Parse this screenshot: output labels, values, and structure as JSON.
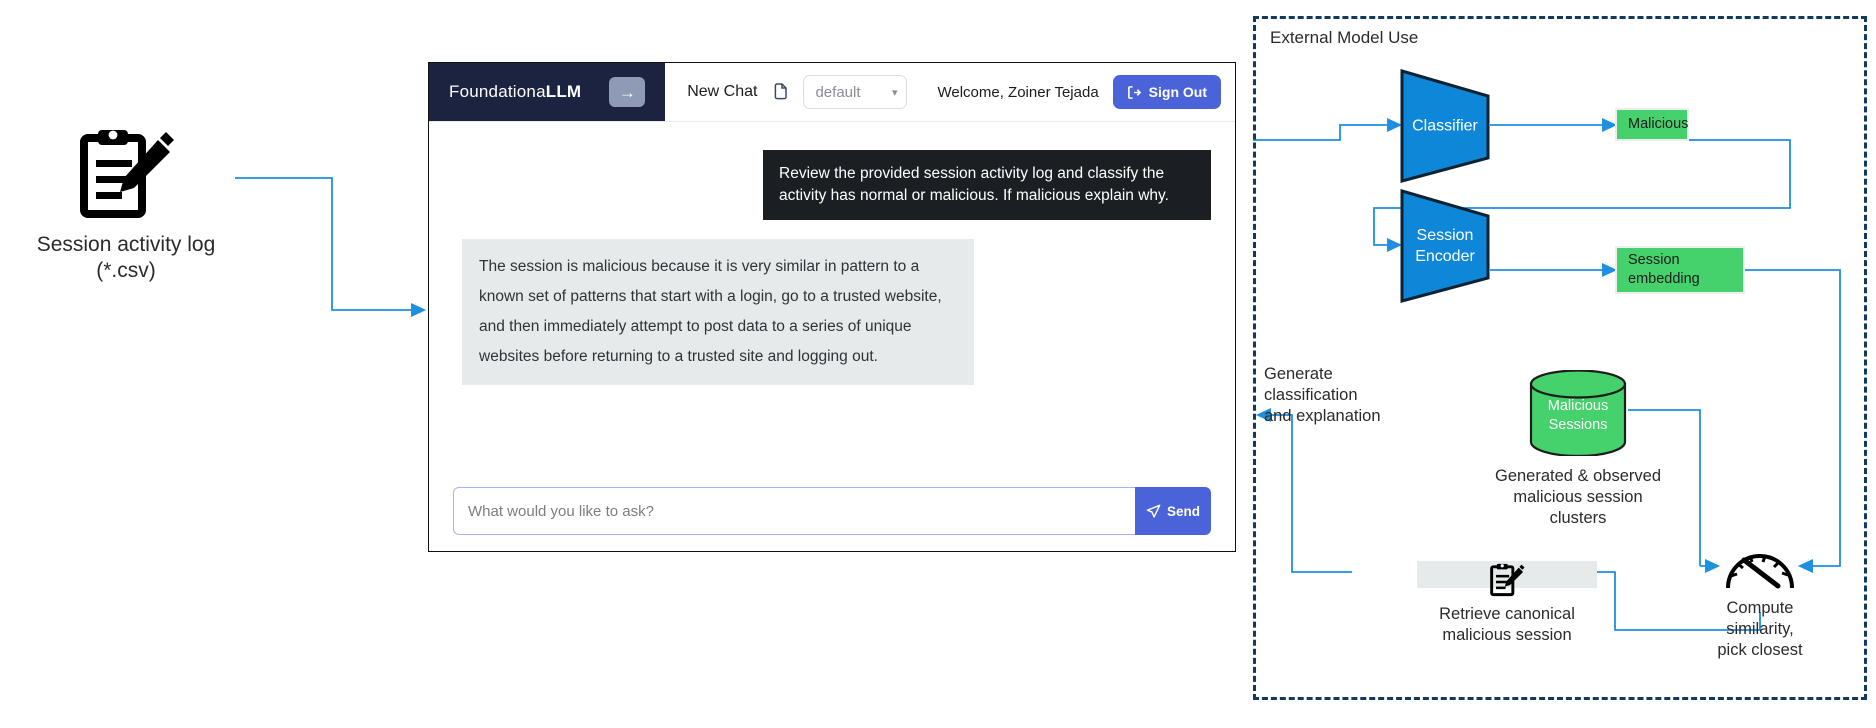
{
  "source_node": {
    "icon": "clipboard-pencil-icon",
    "label_line1": "Session activity log",
    "label_line2": "(*.csv)"
  },
  "app": {
    "brand_prefix": "Foundationa",
    "brand_suffix": "LLM",
    "brand_toggle_icon": "arrow-right-icon",
    "new_chat_label": "New Chat",
    "copy_icon": "copy-icon",
    "agent_select_value": "default",
    "agent_select_chevron": "chevron-down-icon",
    "welcome_label": "Welcome, Zoiner Tejada",
    "sign_out_label": "Sign Out",
    "sign_out_icon": "sign-out-icon",
    "user_message": "Review the provided session activity log and classify the activity has normal or malicious. If malicious explain why.",
    "assistant_message": "The session is malicious because it is very similar in pattern to a known set of patterns that start with a login, go to a trusted website, and then immediately attempt to post data to a series of unique websites before returning to a trusted site and logging out.",
    "input_placeholder": "What would you like to ask?",
    "input_value": "",
    "send_label": "Send",
    "send_icon": "paper-plane-icon"
  },
  "external_panel": {
    "title": "External Model Use",
    "classifier_label": "Classifier",
    "malicious_label": "Malicious",
    "session_encoder_label_line1": "Session",
    "session_encoder_label_line2": "Encoder",
    "session_embedding_label_line1": "Session",
    "session_embedding_label_line2": "embedding",
    "cylinder_label_line1": "Malicious",
    "cylinder_label_line2": "Sessions",
    "cylinder_caption_line1": "Generated & observed",
    "cylinder_caption_line2": "malicious session",
    "cylinder_caption_line3": "clusters",
    "retrieve_caption_line1": "Retrieve canonical",
    "retrieve_caption_line2": "malicious session",
    "retrieve_icon": "clipboard-pencil-icon",
    "gauge_icon": "gauge-icon",
    "compute_caption_line1": "Compute",
    "compute_caption_line2": "similarity,",
    "compute_caption_line3": "pick closest",
    "generate_caption_line1": "Generate",
    "generate_caption_line2": "classification",
    "generate_caption_line3": "and explanation"
  },
  "colors": {
    "brand_navy": "#1b2340",
    "accent_blue": "#4a63d8",
    "flow_blue": "#1f8fe0",
    "node_blue": "#0f87d8",
    "node_green": "#45d26c",
    "panel_border": "#123a5e",
    "bubble_dark": "#1b1f24",
    "bubble_light": "#e7eaea"
  }
}
